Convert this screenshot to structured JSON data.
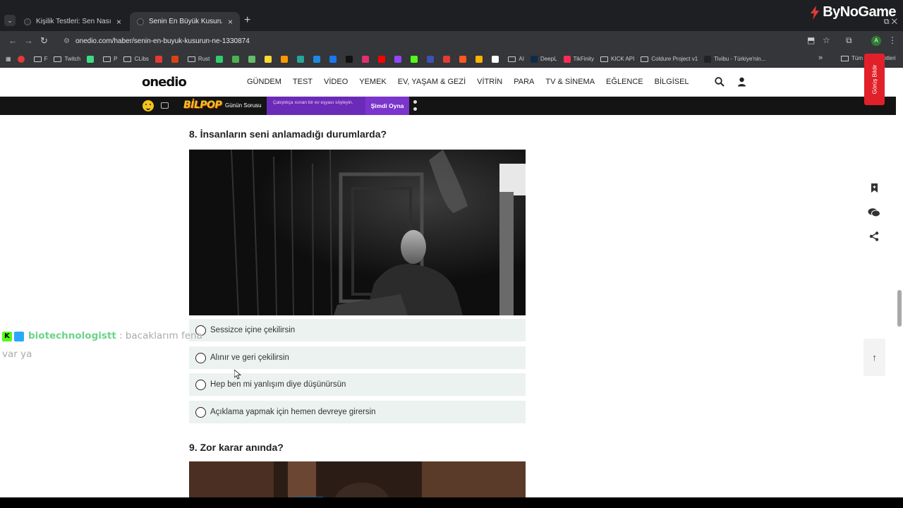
{
  "browser": {
    "tabs": [
      {
        "title": "Kişilik Testleri: Sen Nasıl Birisin?",
        "active": false
      },
      {
        "title": "Senin En Büyük Kusurun Ne? - Onedio",
        "active": true
      }
    ],
    "url": "onedio.com/haber/senin-en-buyuk-kusurun-ne-1330874",
    "profile_initial": "A",
    "overlay_brand": "ByNoGame",
    "bookmarks": [
      {
        "label": "F",
        "type": "folder"
      },
      {
        "label": "Twitch",
        "type": "folder"
      },
      {
        "label": "",
        "type": "icon",
        "color": "#3ddc84"
      },
      {
        "label": "P",
        "type": "folder"
      },
      {
        "label": "CLibs",
        "type": "folder"
      },
      {
        "label": "",
        "type": "icon",
        "color": "#e53935"
      },
      {
        "label": "",
        "type": "icon",
        "color": "#d84315"
      },
      {
        "label": "Rust",
        "type": "folder"
      },
      {
        "label": "",
        "type": "icon",
        "color": "#2ecc71"
      },
      {
        "label": "",
        "type": "icon",
        "color": "#4caf50"
      },
      {
        "label": "",
        "type": "icon",
        "color": "#66bb6a"
      },
      {
        "label": "",
        "type": "icon",
        "color": "#fdd835"
      },
      {
        "label": "",
        "type": "icon",
        "color": "#ff9800"
      },
      {
        "label": "",
        "type": "icon",
        "color": "#26a69a"
      },
      {
        "label": "",
        "type": "icon",
        "color": "#1e88e5"
      },
      {
        "label": "",
        "type": "icon",
        "color": "#1877f2"
      },
      {
        "label": "",
        "type": "icon",
        "color": "#111111"
      },
      {
        "label": "",
        "type": "icon",
        "color": "#e1306c"
      },
      {
        "label": "",
        "type": "icon",
        "color": "#ff0000"
      },
      {
        "label": "",
        "type": "icon",
        "color": "#9146ff"
      },
      {
        "label": "",
        "type": "icon",
        "color": "#53fc18"
      },
      {
        "label": "",
        "type": "icon",
        "color": "#3f51b5"
      },
      {
        "label": "",
        "type": "icon",
        "color": "#e53935"
      },
      {
        "label": "",
        "type": "icon",
        "color": "#ff5722"
      },
      {
        "label": "",
        "type": "icon",
        "color": "#ffb300"
      },
      {
        "label": "",
        "type": "icon",
        "color": "#ffffff"
      },
      {
        "label": "AI",
        "type": "folder"
      },
      {
        "label": "DeepL",
        "type": "icon",
        "color": "#0f2b46"
      },
      {
        "label": "TikFinity",
        "type": "icon",
        "color": "#fe2c55"
      },
      {
        "label": "KICK API",
        "type": "folder"
      },
      {
        "label": "Coldure Project v1",
        "type": "folder"
      },
      {
        "label": "Tivibu - Türkiye'nin...",
        "type": "icon",
        "color": "#222222"
      }
    ],
    "all_bookmarks_label": "Tüm Yer İşaretleri"
  },
  "site": {
    "logo": "onedio",
    "nav": [
      "GÜNDEM",
      "TEST",
      "VİDEO",
      "YEMEK",
      "EV, YAŞAM & GEZİ",
      "VİTRİN",
      "PARA",
      "TV & SİNEMA",
      "EĞLENCE",
      "BİLGİSEL"
    ],
    "bilpop": {
      "logo": "BİLPOP",
      "daily_question": "Günün Sorusu",
      "question_text": "Çalıştıkça ısınan bir ev eşyası söyleyin.",
      "play_label": "Şimdi Oyna"
    }
  },
  "article": {
    "q8": {
      "title": "8. İnsanların seni anlamadığı durumlarda?",
      "options": [
        "Sessizce içine çekilirsin",
        "Alınır ve geri çekilirsin",
        "Hep ben mi yanlışım diye düşünürsün",
        "Açıklama yapmak için hemen devreye girersin"
      ]
    },
    "q9": {
      "title": "9. Zor karar anında?"
    }
  },
  "sidebar": {
    "feedback_label": "Görüş Bildir"
  },
  "chat": {
    "username": "biotechnologistt",
    "separator": ":",
    "message_line1": "bacaklarım fena",
    "message_line2": "var ya"
  }
}
